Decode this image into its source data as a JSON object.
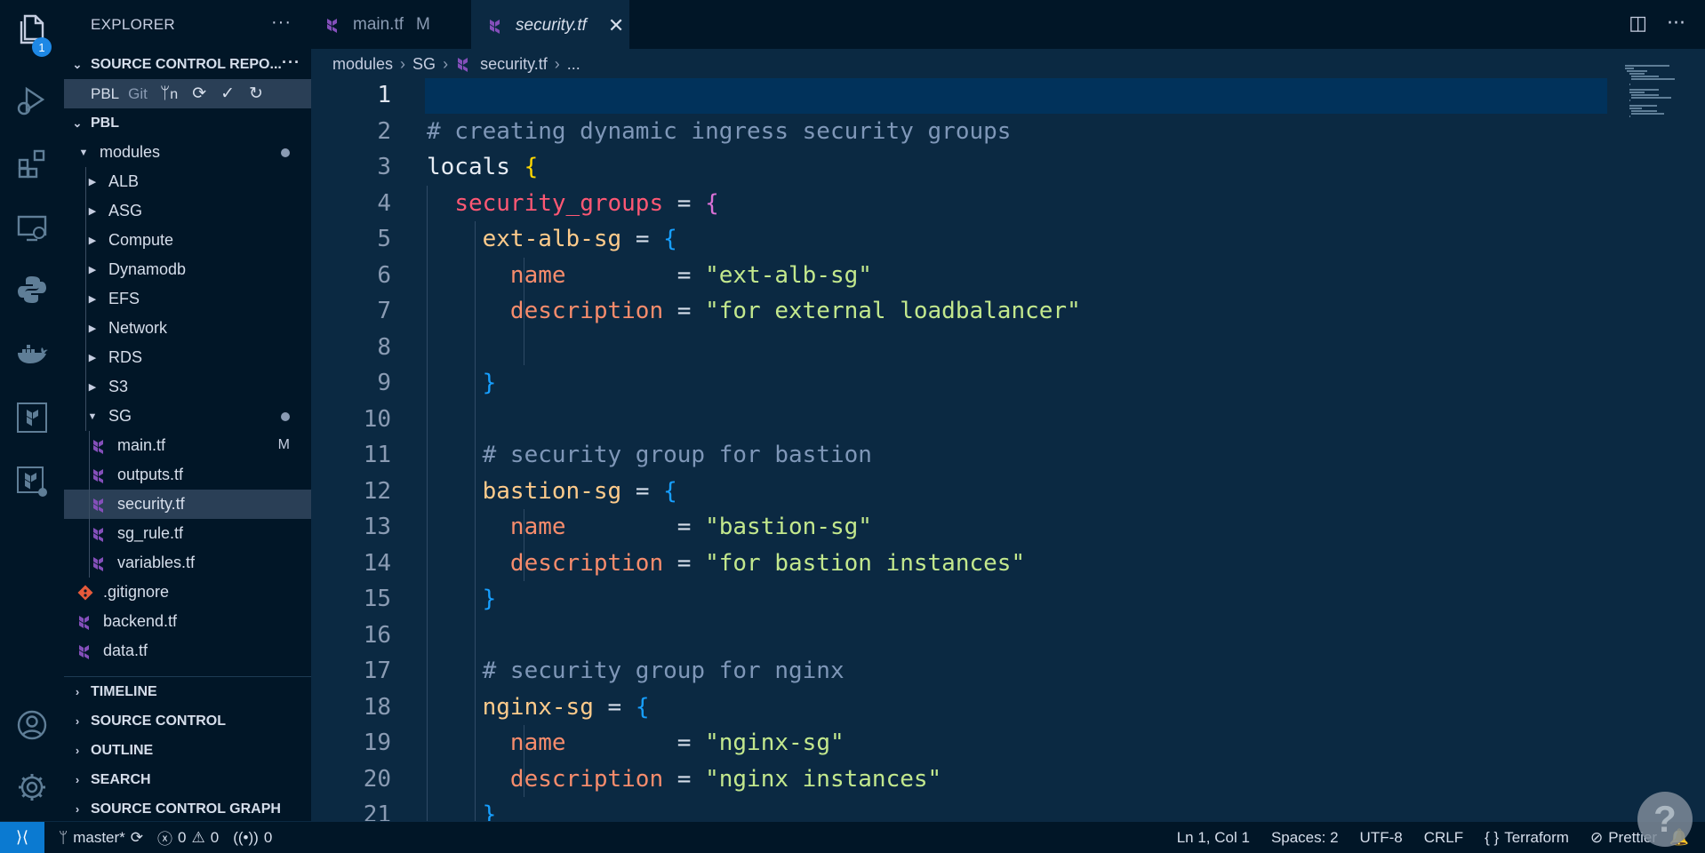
{
  "activity": {
    "explorer_badge": "1"
  },
  "sidebar": {
    "title": "EXPLORER",
    "more": "···",
    "repos_section": "SOURCE CONTROL REPO...",
    "repo": {
      "name": "PBL",
      "type": "Git",
      "branch_short": "n"
    },
    "workspace": "PBL",
    "tree": [
      {
        "label": "modules",
        "indent": 1,
        "kind": "folder-open",
        "mark": "dot"
      },
      {
        "label": "ALB",
        "indent": 2,
        "kind": "folder"
      },
      {
        "label": "ASG",
        "indent": 2,
        "kind": "folder"
      },
      {
        "label": "Compute",
        "indent": 2,
        "kind": "folder"
      },
      {
        "label": "Dynamodb",
        "indent": 2,
        "kind": "folder"
      },
      {
        "label": "EFS",
        "indent": 2,
        "kind": "folder"
      },
      {
        "label": "Network",
        "indent": 2,
        "kind": "folder"
      },
      {
        "label": "RDS",
        "indent": 2,
        "kind": "folder"
      },
      {
        "label": "S3",
        "indent": 2,
        "kind": "folder"
      },
      {
        "label": "SG",
        "indent": 2,
        "kind": "folder-open",
        "mark": "dot"
      },
      {
        "label": "main.tf",
        "indent": 3,
        "kind": "tf",
        "mark": "M"
      },
      {
        "label": "outputs.tf",
        "indent": 3,
        "kind": "tf"
      },
      {
        "label": "security.tf",
        "indent": 3,
        "kind": "tf",
        "selected": true
      },
      {
        "label": "sg_rule.tf",
        "indent": 3,
        "kind": "tf"
      },
      {
        "label": "variables.tf",
        "indent": 3,
        "kind": "tf"
      },
      {
        "label": ".gitignore",
        "indent": 1,
        "kind": "git"
      },
      {
        "label": "backend.tf",
        "indent": 1,
        "kind": "tf"
      },
      {
        "label": "data.tf",
        "indent": 1,
        "kind": "tf"
      }
    ],
    "bottom_sections": [
      "TIMELINE",
      "SOURCE CONTROL",
      "OUTLINE",
      "SEARCH",
      "SOURCE CONTROL GRAPH"
    ]
  },
  "tabs": [
    {
      "label": "main.tf",
      "status": "M"
    },
    {
      "label": "security.tf",
      "active": true,
      "close": "✕"
    }
  ],
  "breadcrumb": [
    "modules",
    "SG",
    "security.tf",
    "..."
  ],
  "code_lines": [
    {
      "n": "1",
      "tokens": []
    },
    {
      "n": "2",
      "tokens": [
        [
          "c",
          "# creating dynamic ingress security groups"
        ]
      ]
    },
    {
      "n": "3",
      "tokens": [
        [
          "k",
          "locals "
        ],
        [
          "br1",
          "{"
        ]
      ]
    },
    {
      "n": "4",
      "guides": 1,
      "tokens": [
        [
          "p",
          "  "
        ],
        [
          "prop",
          "security_groups"
        ],
        [
          "p",
          " = "
        ],
        [
          "br2",
          "{"
        ]
      ]
    },
    {
      "n": "5",
      "guides": 2,
      "tokens": [
        [
          "p",
          "    "
        ],
        [
          "a2",
          "ext-alb-sg"
        ],
        [
          "p",
          " = "
        ],
        [
          "br3",
          "{"
        ]
      ]
    },
    {
      "n": "6",
      "guides": 3,
      "tokens": [
        [
          "p",
          "      "
        ],
        [
          "a1",
          "name"
        ],
        [
          "p",
          "        = "
        ],
        [
          "s",
          "\"ext-alb-sg\""
        ]
      ]
    },
    {
      "n": "7",
      "guides": 3,
      "tokens": [
        [
          "p",
          "      "
        ],
        [
          "a1",
          "description"
        ],
        [
          "p",
          " = "
        ],
        [
          "s",
          "\"for external loadbalancer\""
        ]
      ]
    },
    {
      "n": "8",
      "guides": 3,
      "tokens": []
    },
    {
      "n": "9",
      "guides": 2,
      "tokens": [
        [
          "p",
          "    "
        ],
        [
          "br3",
          "}"
        ]
      ]
    },
    {
      "n": "10",
      "guides": 2,
      "tokens": []
    },
    {
      "n": "11",
      "guides": 2,
      "tokens": [
        [
          "p",
          "    "
        ],
        [
          "c",
          "# security group for bastion"
        ]
      ]
    },
    {
      "n": "12",
      "guides": 2,
      "tokens": [
        [
          "p",
          "    "
        ],
        [
          "a2",
          "bastion-sg"
        ],
        [
          "p",
          " = "
        ],
        [
          "br3",
          "{"
        ]
      ]
    },
    {
      "n": "13",
      "guides": 3,
      "tokens": [
        [
          "p",
          "      "
        ],
        [
          "a1",
          "name"
        ],
        [
          "p",
          "        = "
        ],
        [
          "s",
          "\"bastion-sg\""
        ]
      ]
    },
    {
      "n": "14",
      "guides": 3,
      "tokens": [
        [
          "p",
          "      "
        ],
        [
          "a1",
          "description"
        ],
        [
          "p",
          " = "
        ],
        [
          "s",
          "\"for bastion instances\""
        ]
      ]
    },
    {
      "n": "15",
      "guides": 2,
      "tokens": [
        [
          "p",
          "    "
        ],
        [
          "br3",
          "}"
        ]
      ]
    },
    {
      "n": "16",
      "guides": 2,
      "tokens": []
    },
    {
      "n": "17",
      "guides": 2,
      "tokens": [
        [
          "p",
          "    "
        ],
        [
          "c",
          "# security group for nginx"
        ]
      ]
    },
    {
      "n": "18",
      "guides": 2,
      "tokens": [
        [
          "p",
          "    "
        ],
        [
          "a2",
          "nginx-sg"
        ],
        [
          "p",
          " = "
        ],
        [
          "br3",
          "{"
        ]
      ]
    },
    {
      "n": "19",
      "guides": 3,
      "tokens": [
        [
          "p",
          "      "
        ],
        [
          "a1",
          "name"
        ],
        [
          "p",
          "        = "
        ],
        [
          "s",
          "\"nginx-sg\""
        ]
      ]
    },
    {
      "n": "20",
      "guides": 3,
      "tokens": [
        [
          "p",
          "      "
        ],
        [
          "a1",
          "description"
        ],
        [
          "p",
          " = "
        ],
        [
          "s",
          "\"nginx instances\""
        ]
      ]
    },
    {
      "n": "21",
      "guides": 2,
      "tokens": [
        [
          "p",
          "    "
        ],
        [
          "br3",
          "}"
        ]
      ]
    }
  ],
  "status": {
    "branch": "master*",
    "errors": "0",
    "warnings": "0",
    "ports": "0",
    "position": "Ln 1, Col 1",
    "spaces": "Spaces: 2",
    "encoding": "UTF-8",
    "eol": "CRLF",
    "language": "Terraform",
    "formatter": "Prettier"
  },
  "colors": {
    "background": "#011627",
    "editor": "#0b2942",
    "accent": "#0b7ad1",
    "terraform": "#844fba"
  }
}
